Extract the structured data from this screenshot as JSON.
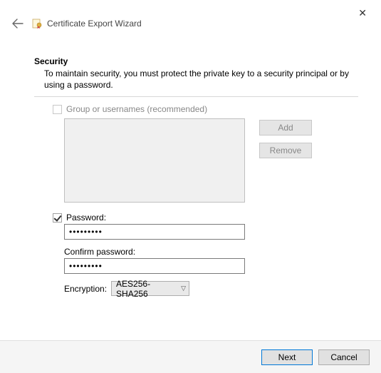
{
  "header": {
    "title": "Certificate Export Wizard"
  },
  "section": {
    "title": "Security",
    "description": "To maintain security, you must protect the private key to a security principal or by using a password."
  },
  "group": {
    "checkbox_checked": false,
    "label": "Group or usernames (recommended)"
  },
  "buttons": {
    "add": "Add",
    "remove": "Remove"
  },
  "password": {
    "checkbox_checked": true,
    "label": "Password:",
    "value": "•••••••••",
    "confirm_label": "Confirm password:",
    "confirm_value": "•••••••••"
  },
  "encryption": {
    "label": "Encryption:",
    "selected": "AES256-SHA256"
  },
  "footer": {
    "next": "Next",
    "cancel": "Cancel"
  }
}
